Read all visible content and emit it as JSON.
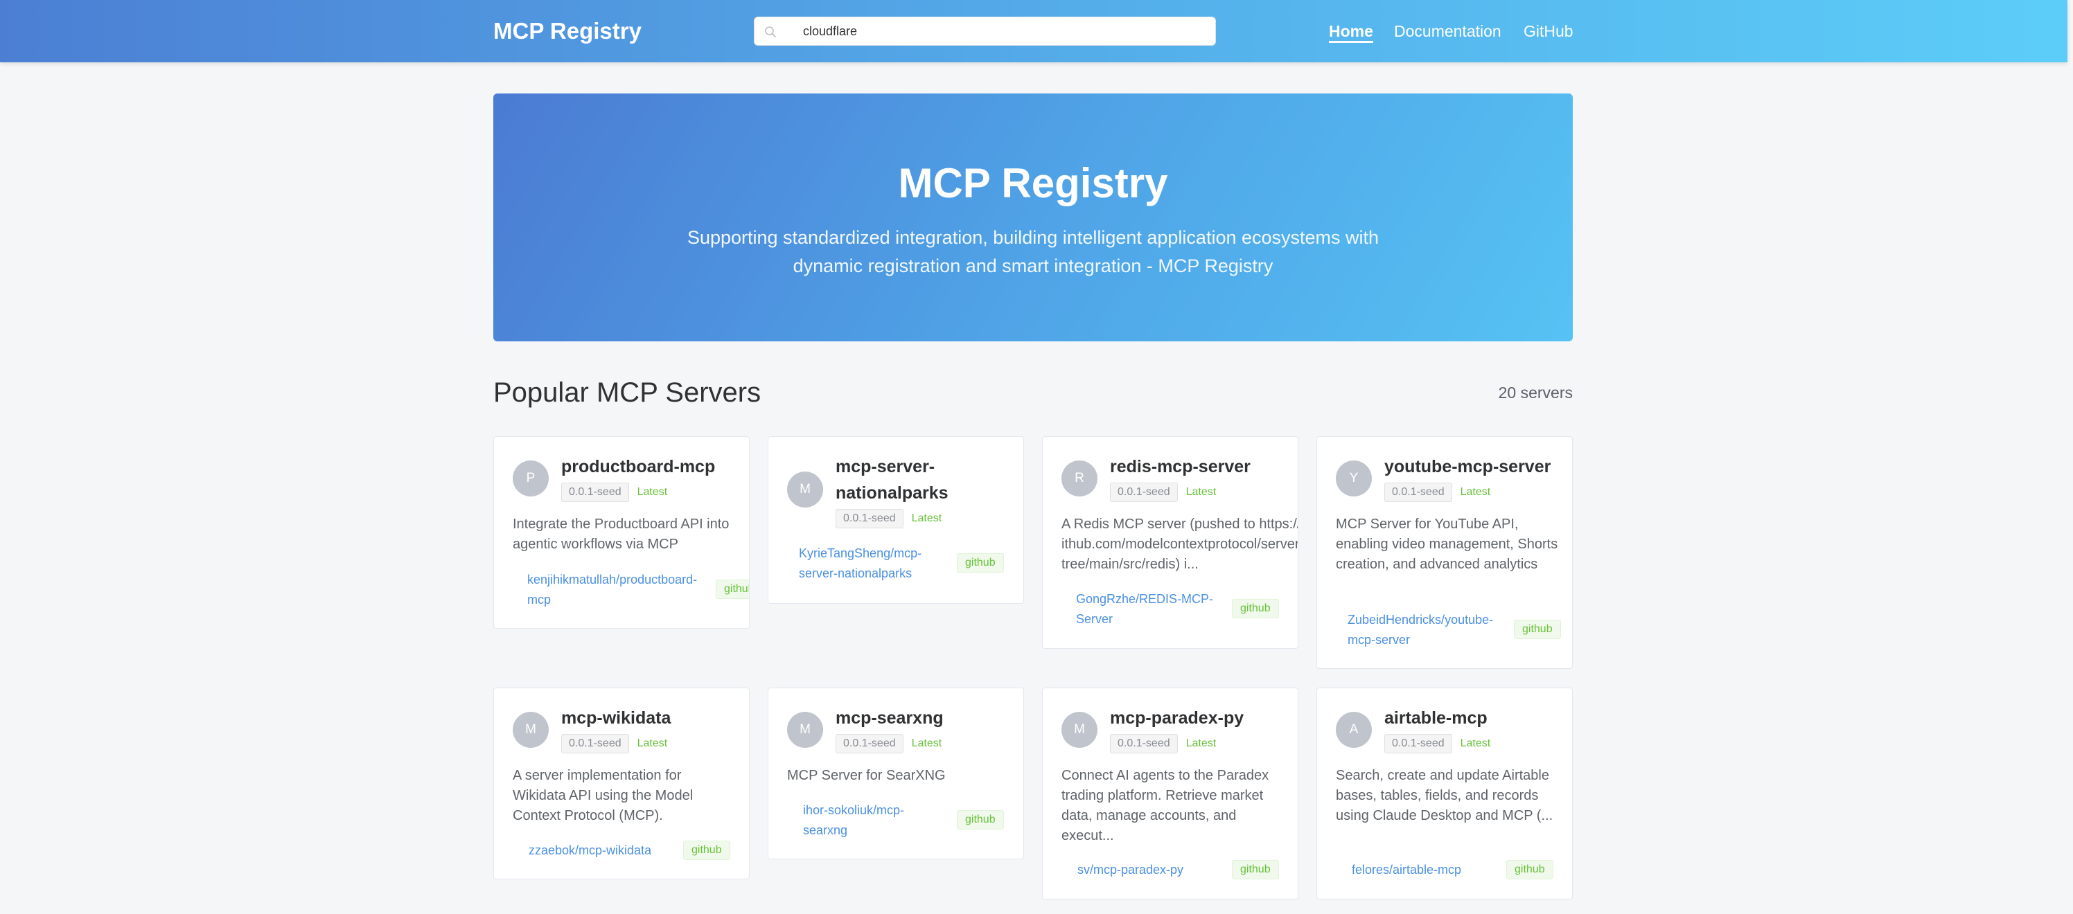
{
  "header": {
    "brand": "MCP Registry",
    "search_value": "cloudflare",
    "nav": [
      "Home",
      "Documentation",
      "GitHub"
    ]
  },
  "hero": {
    "title": "MCP Registry",
    "subtitle": "Supporting standardized integration, building intelligent application ecosystems with dynamic registration and smart integration - MCP Registry"
  },
  "section": {
    "title": "Popular MCP Servers",
    "count": "20 servers"
  },
  "cards": [
    {
      "initial": "P",
      "name": "productboard-mcp",
      "version": "0.0.1-seed",
      "status": "Latest",
      "description": "Integrate the Productboard API into agentic workflows via MCP",
      "repo": "kenjihikmatullah/productboard-mcp",
      "source": "github"
    },
    {
      "initial": "M",
      "name": "mcp-server-nationalparks",
      "version": "0.0.1-seed",
      "status": "Latest",
      "description": "",
      "repo": "KyrieTangSheng/mcp-server-nationalparks",
      "source": "github"
    },
    {
      "initial": "R",
      "name": "redis-mcp-server",
      "version": "0.0.1-seed",
      "status": "Latest",
      "description": "A Redis MCP server (pushed to https://github.com/modelcontextprotocol/servers/tree/main/src/redis) i...",
      "repo": "GongRzhe/REDIS-MCP-Server",
      "source": "github"
    },
    {
      "initial": "Y",
      "name": "youtube-mcp-server",
      "version": "0.0.1-seed",
      "status": "Latest",
      "description": "MCP Server for YouTube API, enabling video management, Shorts creation, and advanced analytics",
      "repo": "ZubeidHendricks/youtube-mcp-server",
      "source": "github"
    },
    {
      "initial": "M",
      "name": "mcp-wikidata",
      "version": "0.0.1-seed",
      "status": "Latest",
      "description": "A server implementation for Wikidata API using the Model Context Protocol (MCP).",
      "repo": "zzaebok/mcp-wikidata",
      "source": "github"
    },
    {
      "initial": "M",
      "name": "mcp-searxng",
      "version": "0.0.1-seed",
      "status": "Latest",
      "description": "MCP Server for SearXNG",
      "repo": "ihor-sokoliuk/mcp-searxng",
      "source": "github"
    },
    {
      "initial": "M",
      "name": "mcp-paradex-py",
      "version": "0.0.1-seed",
      "status": "Latest",
      "description": "Connect AI agents to the Paradex trading platform. Retrieve market data, manage accounts, and execut...",
      "repo": "sv/mcp-paradex-py",
      "source": "github"
    },
    {
      "initial": "A",
      "name": "airtable-mcp",
      "version": "0.0.1-seed",
      "status": "Latest",
      "description": "Search, create and update Airtable bases, tables, fields, and records using Claude Desktop and MCP (...",
      "repo": "felores/airtable-mcp",
      "source": "github"
    }
  ],
  "colors": {
    "header_gradient_start": "#4c7fd4",
    "header_gradient_end": "#5ccdf8",
    "link": "#4a90e2",
    "success": "#67c23a"
  },
  "icons": {
    "search": "search-icon"
  }
}
